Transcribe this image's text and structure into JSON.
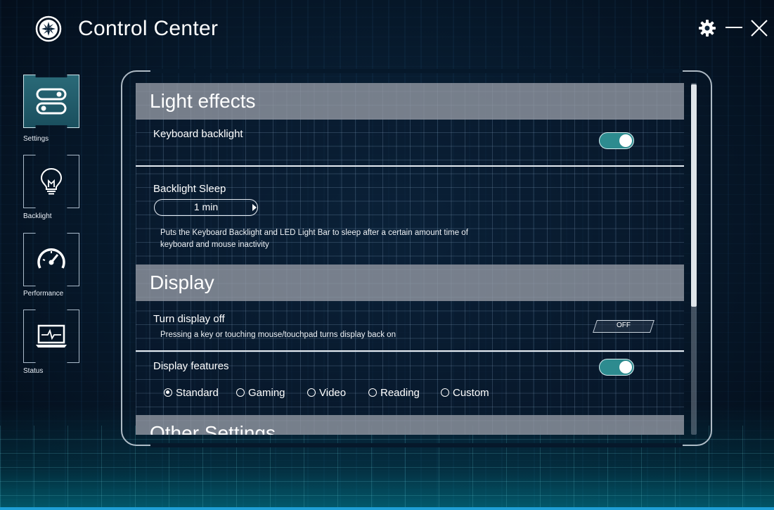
{
  "app": {
    "title": "Control Center",
    "logo_icon": "fan-icon",
    "window_controls": [
      "gear-icon",
      "minimize-icon",
      "close-icon"
    ]
  },
  "sidebar": {
    "items": [
      {
        "label": "Settings",
        "icon": "toggles-icon",
        "active": true
      },
      {
        "label": "Backlight",
        "icon": "lightbulb-icon",
        "active": false
      },
      {
        "label": "Performance",
        "icon": "speedometer-icon",
        "active": false
      },
      {
        "label": "Status",
        "icon": "laptop-monitor-icon",
        "active": false
      }
    ]
  },
  "sections": {
    "light_effects": {
      "title": "Light effects",
      "keyboard_backlight": {
        "label": "Keyboard backlight",
        "state": "on"
      },
      "backlight_sleep": {
        "label": "Backlight Sleep",
        "value": "1 min",
        "description": "Puts the Keyboard Backlight and LED Light Bar to sleep after a certain amount time of keyboard and mouse inactivity"
      }
    },
    "display": {
      "title": "Display",
      "turn_display_off": {
        "label": "Turn display off",
        "description": "Pressing a key or touching mouse/touchpad turns display back on",
        "button": "OFF"
      },
      "display_features": {
        "label": "Display features",
        "state": "on",
        "options": [
          "Standard",
          "Gaming",
          "Video",
          "Reading",
          "Custom"
        ],
        "selected": "Standard"
      }
    },
    "other_settings": {
      "title": "Other Settings"
    }
  },
  "colors": {
    "accent_toggle": "#2d8b8f",
    "section_header": "#96979f",
    "bottom_bar": "#1e9fd6"
  }
}
